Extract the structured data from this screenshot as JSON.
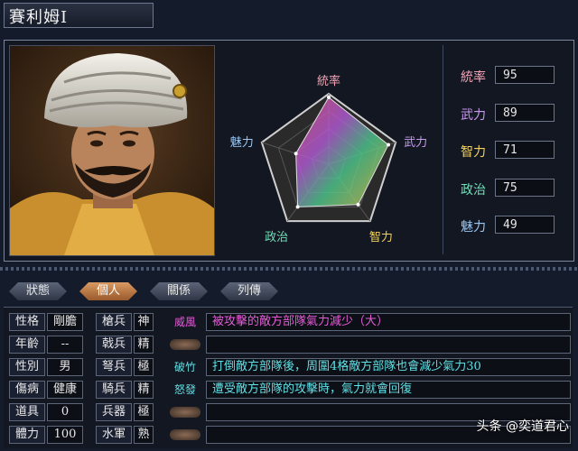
{
  "character": {
    "name": "賽利姆I"
  },
  "radar": {
    "axes": [
      "統率",
      "武力",
      "智力",
      "政治",
      "魅力"
    ],
    "values": [
      95,
      89,
      71,
      75,
      49
    ],
    "max": 100
  },
  "stats": [
    {
      "label": "統率",
      "value": "95",
      "color": "#f2a4b5"
    },
    {
      "label": "武力",
      "value": "89",
      "color": "#c99af2"
    },
    {
      "label": "智力",
      "value": "71",
      "color": "#f2d35e"
    },
    {
      "label": "政治",
      "value": "75",
      "color": "#6fe0b7"
    },
    {
      "label": "魅力",
      "value": "49",
      "color": "#9bc7f2"
    }
  ],
  "tabs": [
    {
      "label": "狀態"
    },
    {
      "label": "個人"
    },
    {
      "label": "關係"
    },
    {
      "label": "列傳"
    }
  ],
  "attributes": {
    "personality_label": "性格",
    "personality": "剛膽",
    "age_label": "年齡",
    "age": "--",
    "gender_label": "性別",
    "gender": "男",
    "illness_label": "傷病",
    "illness": "健康",
    "item_label": "道具",
    "item": "0",
    "stamina_label": "體力",
    "stamina": "100"
  },
  "troops": [
    {
      "label": "槍兵",
      "grade": "神"
    },
    {
      "label": "戟兵",
      "grade": "精"
    },
    {
      "label": "弩兵",
      "grade": "極"
    },
    {
      "label": "騎兵",
      "grade": "精"
    },
    {
      "label": "兵器",
      "grade": "極"
    },
    {
      "label": "水軍",
      "grade": "熟"
    }
  ],
  "skills": [
    {
      "name": "威風",
      "desc": "被攻擊的敵方部隊氣力減少（大）",
      "color": "#e75ad8"
    },
    {
      "name": "",
      "desc": "",
      "color": ""
    },
    {
      "name": "破竹",
      "desc": "打倒敵方部隊後，周圍4格敵方部隊也會減少氣力30",
      "color": "#5fe1e6"
    },
    {
      "name": "怒發",
      "desc": "遭受敵方部隊的攻擊時，氣力就會回復",
      "color": "#5fe1e6"
    },
    {
      "name": "",
      "desc": "",
      "color": ""
    },
    {
      "name": "",
      "desc": "",
      "color": ""
    }
  ],
  "watermark": "头条 @奕道君心"
}
